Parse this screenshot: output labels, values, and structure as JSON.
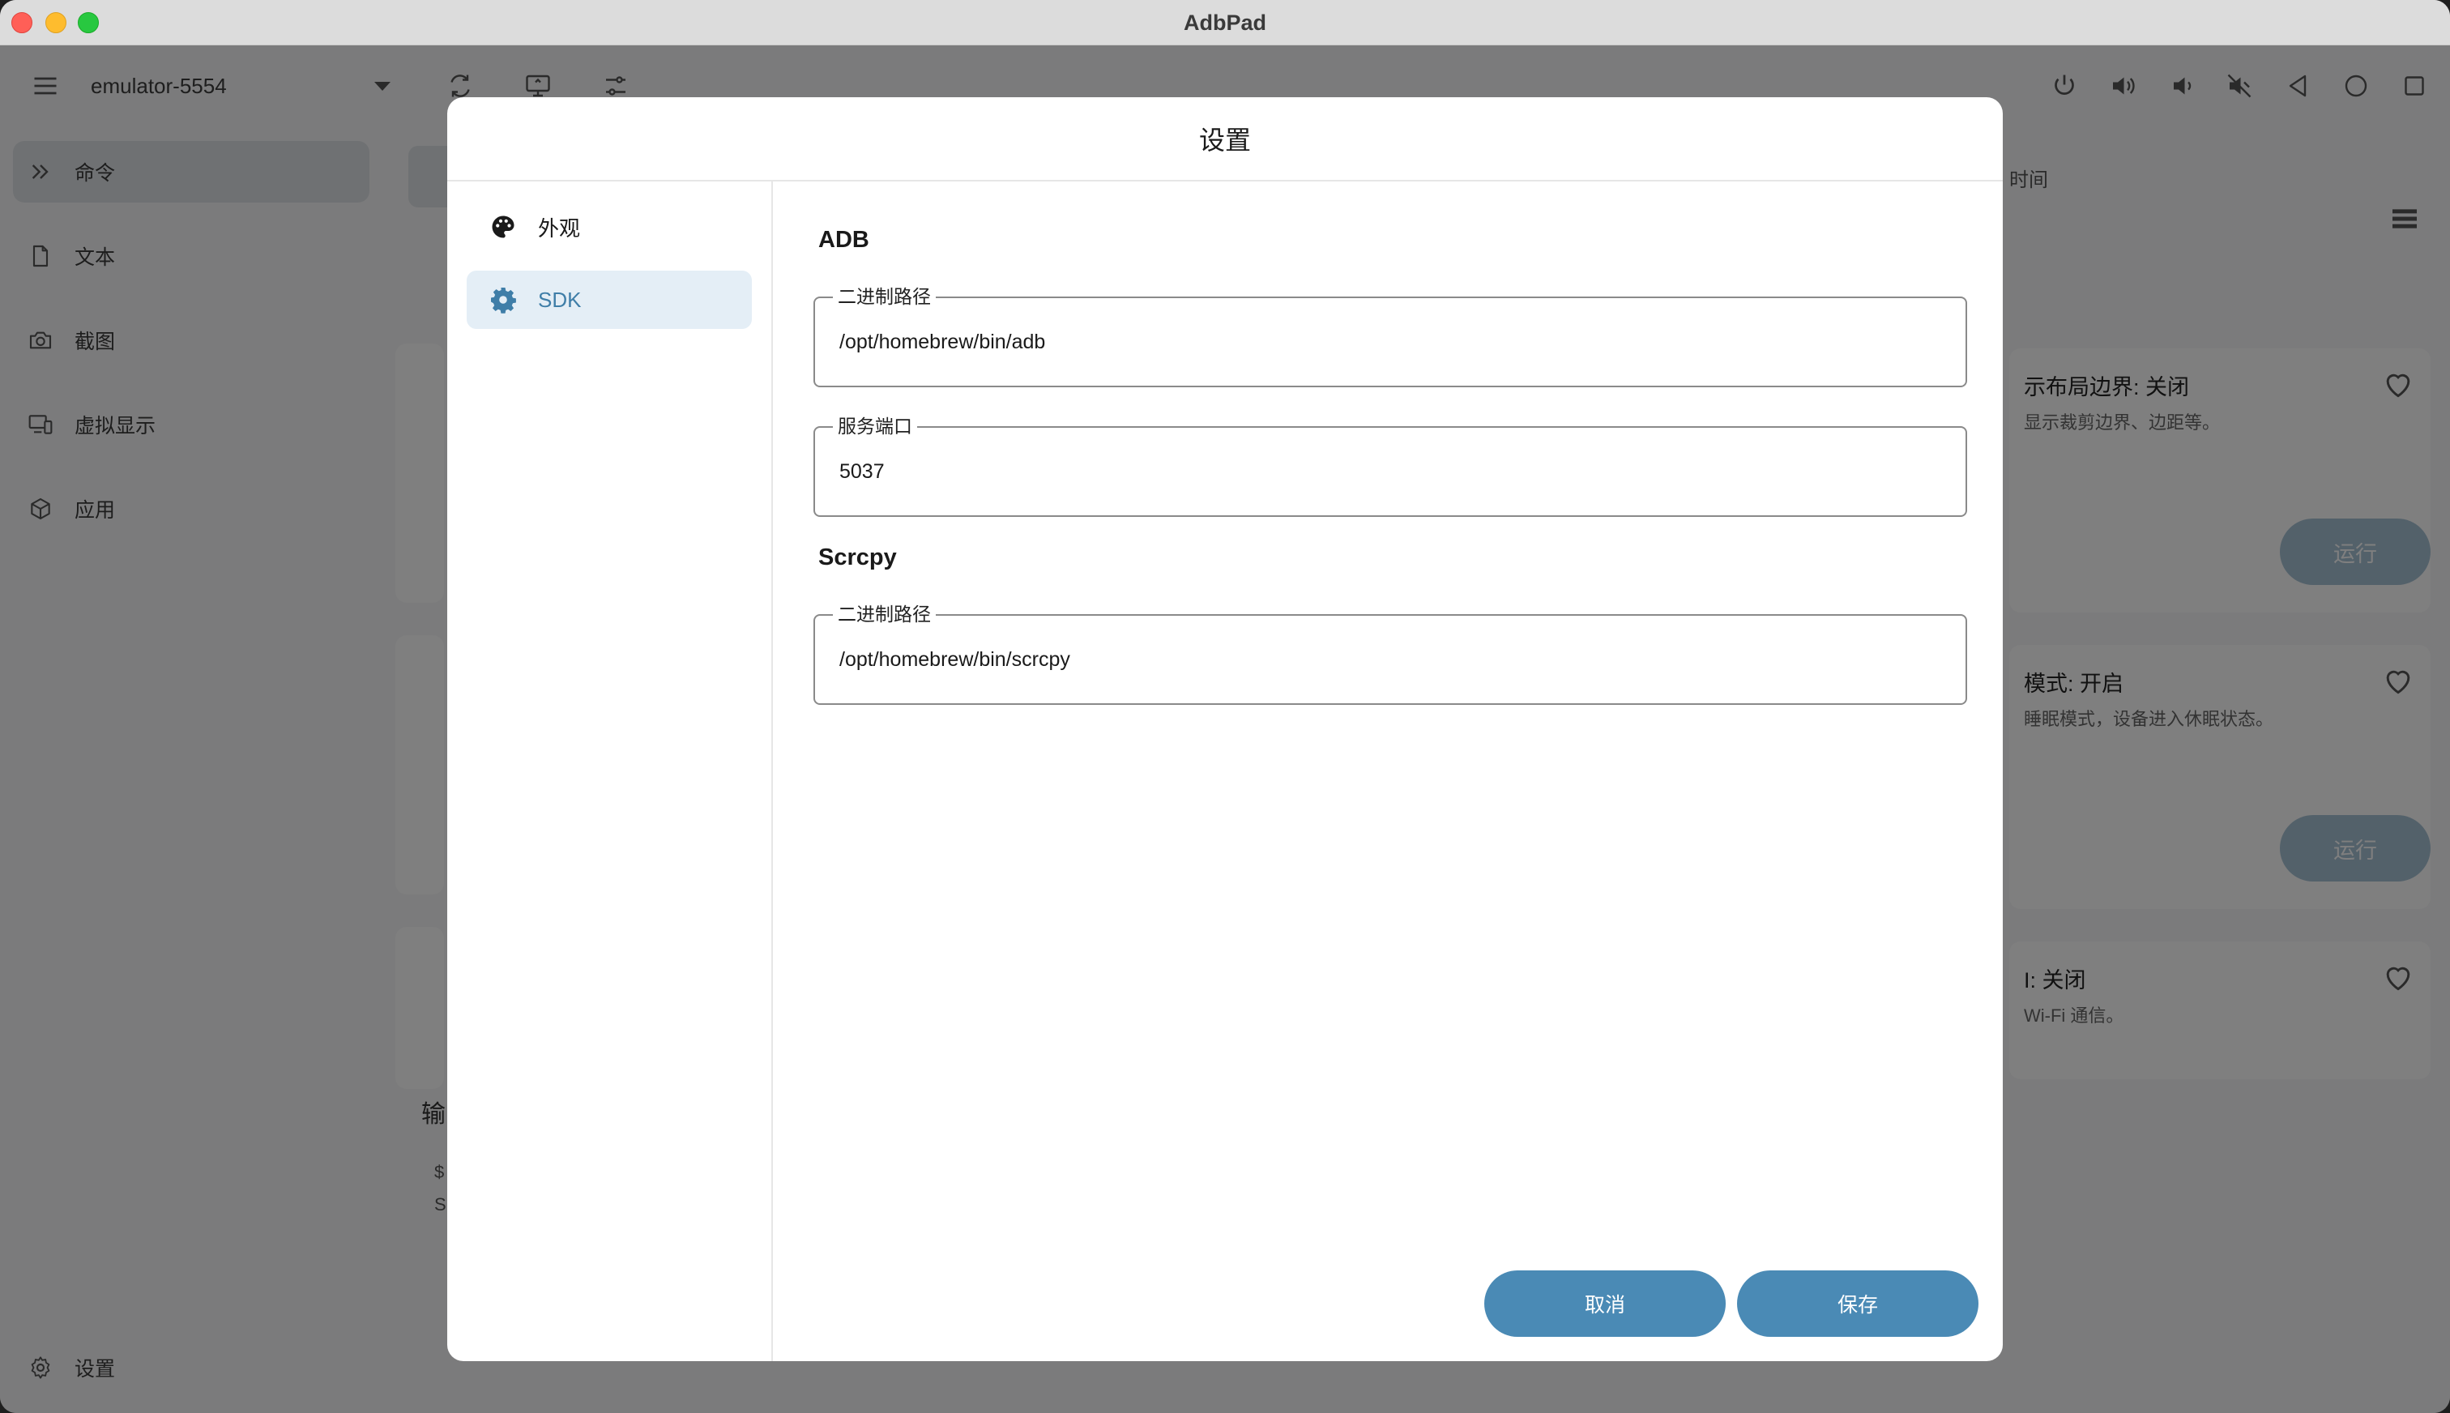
{
  "window": {
    "title": "AdbPad"
  },
  "toolbar": {
    "device": "emulator-5554",
    "left_icons": [
      "menu-icon",
      "refresh-icon",
      "screen-mirror-icon",
      "tune-icon"
    ],
    "right_icons": [
      "power-icon",
      "volume-up-icon",
      "volume-down-icon",
      "volume-mute-icon",
      "back-icon",
      "home-icon",
      "recents-icon"
    ]
  },
  "sidebar": {
    "items": [
      {
        "label": "命令",
        "icon": "double-chevron-icon"
      },
      {
        "label": "文本",
        "icon": "file-icon"
      },
      {
        "label": "截图",
        "icon": "camera-icon"
      },
      {
        "label": "虚拟显示",
        "icon": "devices-icon"
      },
      {
        "label": "应用",
        "icon": "package-icon"
      }
    ],
    "settings_label": "设置"
  },
  "background": {
    "column_header": "时间",
    "output_label": "输",
    "output_lines": [
      "$",
      "S"
    ],
    "cards": [
      {
        "title": "示布局边界: 关闭",
        "desc": "显示裁剪边界、边距等。",
        "button": "运行"
      },
      {
        "title": "模式: 开启",
        "desc": "睡眠模式，设备进入休眠状态。",
        "button": "运行"
      },
      {
        "title": "I: 关闭",
        "desc": "Wi-Fi 通信。",
        "button": ""
      }
    ]
  },
  "dialog": {
    "title": "设置",
    "nav": [
      {
        "label": "外观",
        "icon": "palette-icon"
      },
      {
        "label": "SDK",
        "icon": "gear-icon"
      }
    ],
    "sections": [
      {
        "title": "ADB",
        "fields": [
          {
            "label": "二进制路径",
            "value": "/opt/homebrew/bin/adb"
          },
          {
            "label": "服务端口",
            "value": "5037"
          }
        ]
      },
      {
        "title": "Scrcpy",
        "fields": [
          {
            "label": "二进制路径",
            "value": "/opt/homebrew/bin/scrcpy"
          }
        ]
      }
    ],
    "cancel_label": "取消",
    "save_label": "保存"
  }
}
